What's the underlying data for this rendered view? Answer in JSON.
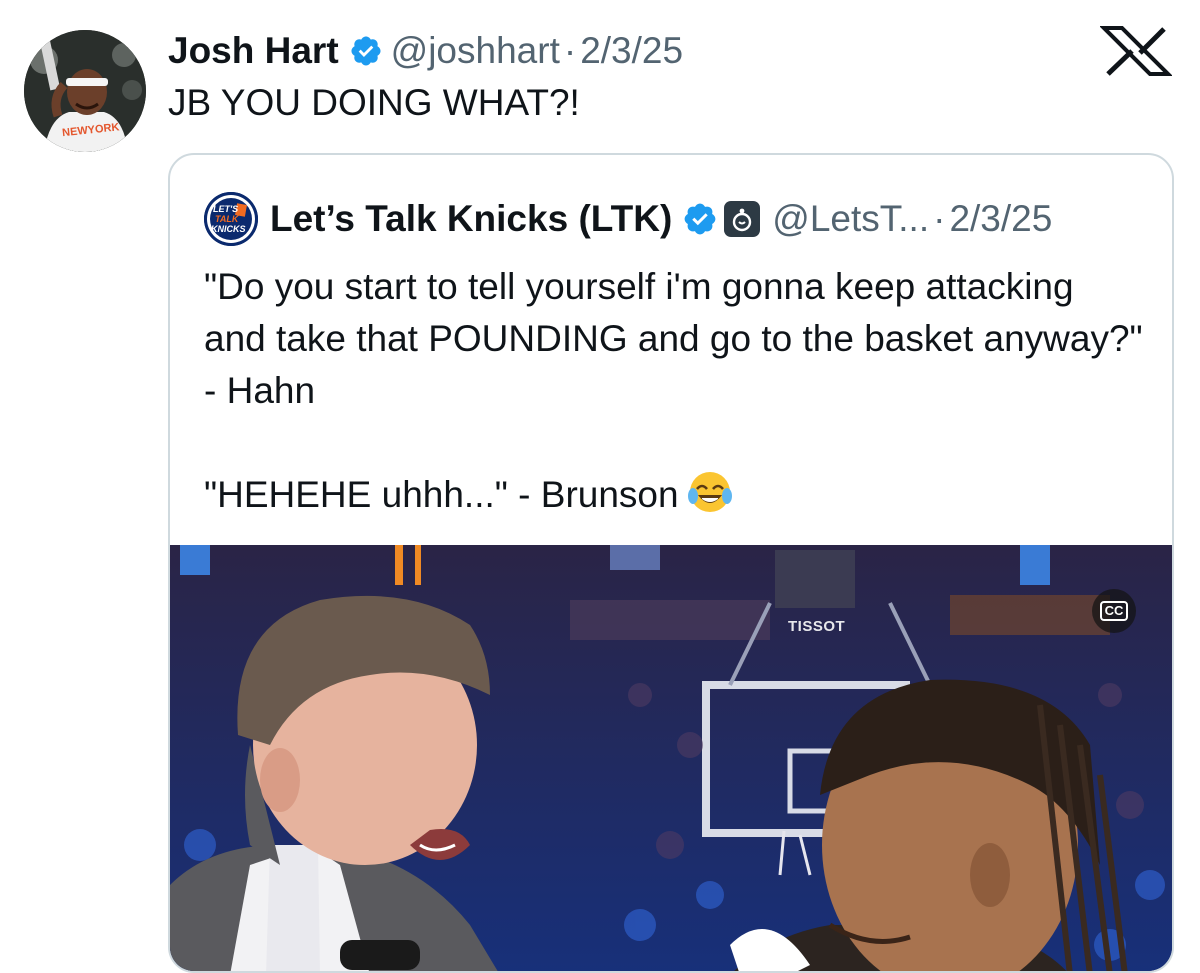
{
  "tweet": {
    "author_name": "Josh Hart",
    "handle": "@joshhart",
    "separator": "·",
    "date": "2/3/25",
    "text": "JB YOU DOING WHAT?!"
  },
  "quoted_tweet": {
    "author_name": "Let’s Talk Knicks (LTK)",
    "handle": "@LetsT...",
    "separator": "·",
    "date": "2/3/25",
    "text_line1": "\"Do you start to tell yourself i'm gonna keep attacking and take that POUNDING and go to the basket anyway?\" - Hahn",
    "text_line2": "\"HEHEHE uhhh...\" - Brunson",
    "emoji": "face-with-tears-of-joy",
    "avatar_text": [
      "LET'S",
      "TALK",
      "KNICKS"
    ],
    "media": {
      "captions_label": "CC",
      "arena_sign": "TISSOT"
    }
  },
  "colors": {
    "text": "#0f1419",
    "secondary": "#536471",
    "verified_blue": "#1d9bf0",
    "card_border": "#cfd9de"
  },
  "icons": {
    "platform_logo": "x-logo-icon",
    "verified": "verified-badge-icon",
    "affiliate": "affiliate-badge-icon"
  }
}
